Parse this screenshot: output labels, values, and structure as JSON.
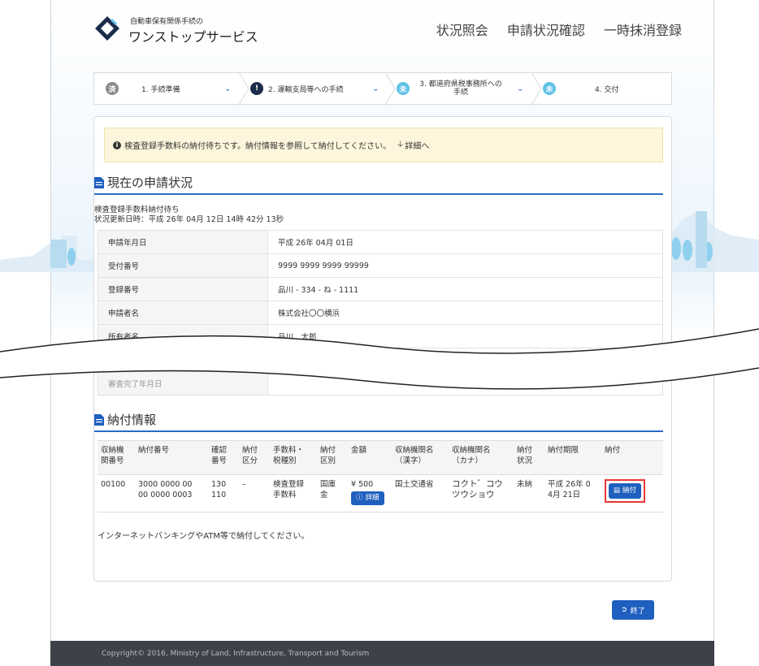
{
  "header": {
    "logo_small": "自動車保有関係手続の",
    "logo_main": "ワンストップサービス",
    "nav": [
      "状況照会",
      "申請状況確認",
      "一時抹消登録"
    ]
  },
  "steps": [
    {
      "badge": "済",
      "label": "1. 手続準備",
      "state": "done"
    },
    {
      "badge": "!",
      "label": "2. 運輸支局等への手続",
      "state": "current"
    },
    {
      "badge": "未",
      "label": "3. 都道府県税事務所への手続",
      "state": "todo"
    },
    {
      "badge": "未",
      "label": "4. 交付",
      "state": "todo"
    }
  ],
  "alert": {
    "icon": "info-circle-icon",
    "text": "検査登録手数料の納付待ちです。納付情報を参照して納付してください。",
    "link": "詳細へ"
  },
  "status_section": {
    "title": "現在の申請状況",
    "status_line": "検査登録手数料納付待ち",
    "updated_line": "状況更新日時：平成 26年 04月 12日 14時 42分 13秒",
    "rows": [
      {
        "k": "申請年月日",
        "v": "平成 26年 04月 01日"
      },
      {
        "k": "受付番号",
        "v": "9999 9999 9999 99999"
      },
      {
        "k": "登録番号",
        "v": "品川 - 334 - ね - 1111"
      },
      {
        "k": "申請者名",
        "v": "株式会社〇〇横浜"
      },
      {
        "k": "所有者名",
        "v": "品川　太郎"
      },
      {
        "k": "審査完了年月日",
        "v": ""
      }
    ]
  },
  "payment_section": {
    "title": "納付情報",
    "headers": [
      "収納機\n関番号",
      "納付番号",
      "確認\n番号",
      "納付\n区分",
      "手数料・\n税種別",
      "納付\n区別",
      "金額",
      "収納機関名\n（漢字）",
      "収納機関名\n（カナ）",
      "納付\n状況",
      "納付期限",
      "納付"
    ],
    "row": {
      "inst_no": "00100",
      "pay_no": "3000 0000 00\n00 0000 0003",
      "confirm_no": "130\n110",
      "pay_div": "–",
      "fee_type": "検査登録\n手数料",
      "pay_kind": "国庫\n金",
      "amount": "¥ 500",
      "detail_btn": "詳細",
      "inst_kanji": "国土交通省",
      "inst_kana": "コクト゛コウ\nツウショウ",
      "pay_status": "未納",
      "deadline": "平成 26年 0\n4月 21日",
      "pay_btn": "納付"
    },
    "note": "インターネットバンキングやATM等で納付してください。"
  },
  "end_button": "終了",
  "footer": "Copyright© 2016, Ministry of Land, Infrastructure, Transport and Tourism",
  "colors": {
    "accent": "#1f5fbf",
    "alert_bg": "#fdf6dc",
    "highlight": "#e53935",
    "footer_bg": "#3d4249"
  }
}
